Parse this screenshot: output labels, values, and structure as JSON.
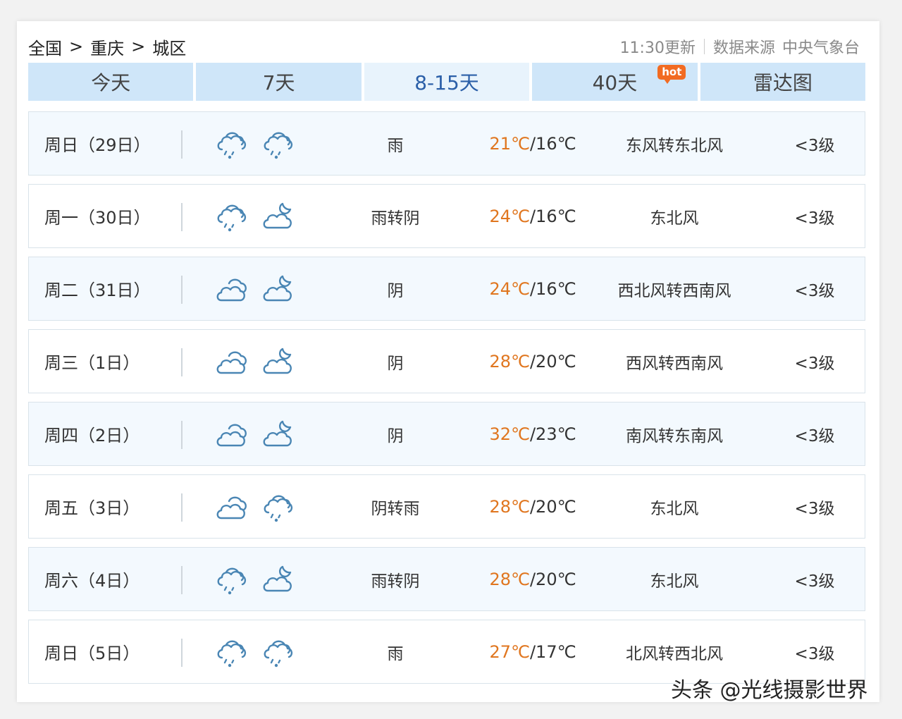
{
  "breadcrumb": {
    "items": [
      "全国",
      "重庆",
      "城区"
    ],
    "separator": ">"
  },
  "update": {
    "time_text": "11:30更新",
    "source_label": "数据来源",
    "source_name": "中央气象台"
  },
  "tabs": [
    {
      "label": "今天",
      "active": false
    },
    {
      "label": "7天",
      "active": false
    },
    {
      "label": "8-15天",
      "active": true
    },
    {
      "label": "40天",
      "active": false,
      "badge": "hot"
    },
    {
      "label": "雷达图",
      "active": false
    }
  ],
  "colors": {
    "accent": "#2b5fa8",
    "tab_bg": "#cfe6f9",
    "high_temp": "#e0761f",
    "hot_badge": "#f26b22",
    "icon": "#4a86b4"
  },
  "days": [
    {
      "date": "周日（29日）",
      "icon_day": "rain-cloud-icon",
      "icon_night": "rain-cloud-icon",
      "desc": "雨",
      "high": "21℃",
      "low": "16℃",
      "wind": "东风转东北风",
      "level": "<3级"
    },
    {
      "date": "周一（30日）",
      "icon_day": "rain-cloud-icon",
      "icon_night": "cloud-moon-icon",
      "desc": "雨转阴",
      "high": "24℃",
      "low": "16℃",
      "wind": "东北风",
      "level": "<3级"
    },
    {
      "date": "周二（31日）",
      "icon_day": "overcast-icon",
      "icon_night": "cloud-moon-icon",
      "desc": "阴",
      "high": "24℃",
      "low": "16℃",
      "wind": "西北风转西南风",
      "level": "<3级"
    },
    {
      "date": "周三（1日）",
      "icon_day": "overcast-icon",
      "icon_night": "cloud-moon-icon",
      "desc": "阴",
      "high": "28℃",
      "low": "20℃",
      "wind": "西风转西南风",
      "level": "<3级"
    },
    {
      "date": "周四（2日）",
      "icon_day": "overcast-icon",
      "icon_night": "cloud-moon-icon",
      "desc": "阴",
      "high": "32℃",
      "low": "23℃",
      "wind": "南风转东南风",
      "level": "<3级"
    },
    {
      "date": "周五（3日）",
      "icon_day": "overcast-icon",
      "icon_night": "rain-cloud-icon",
      "desc": "阴转雨",
      "high": "28℃",
      "low": "20℃",
      "wind": "东北风",
      "level": "<3级"
    },
    {
      "date": "周六（4日）",
      "icon_day": "rain-cloud-icon",
      "icon_night": "cloud-moon-icon",
      "desc": "雨转阴",
      "high": "28℃",
      "low": "20℃",
      "wind": "东北风",
      "level": "<3级"
    },
    {
      "date": "周日（5日）",
      "icon_day": "rain-cloud-icon",
      "icon_night": "rain-cloud-icon",
      "desc": "雨",
      "high": "27℃",
      "low": "17℃",
      "wind": "北风转西北风",
      "level": "<3级"
    }
  ],
  "temp_separator": "/",
  "watermark": "头条 @光线摄影世界"
}
